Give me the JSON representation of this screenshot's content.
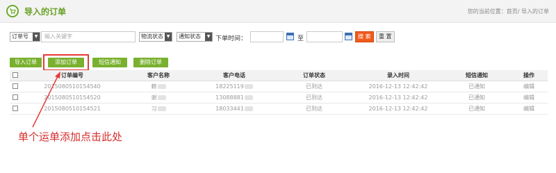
{
  "header": {
    "title": "导入的订单",
    "breadcrumb": "您的当前位置：首页/ 导入的订单"
  },
  "filters": {
    "order_field_select": "订单号",
    "keyword_placeholder": "输入关键字",
    "logistics_select": "物流状态",
    "notify_select": "通知状态",
    "time_label": "下单时间：",
    "to_label": "至",
    "search_button": "搜 索",
    "reset_button": "重 置"
  },
  "actions": {
    "import": "导入订单",
    "add": "添加订单",
    "sms": "短信通知",
    "delete": "删除订单"
  },
  "table": {
    "headers": [
      "订单编号",
      "客户名称",
      "客户电话",
      "订单状态",
      "录入时间",
      "短信通知",
      "操作"
    ],
    "rows": [
      {
        "order_no": "2015080510154540",
        "customer": "赖",
        "phone": "18225119",
        "status": "已到达",
        "time": "2016-12-13 12:42:42",
        "sms": "已通知",
        "op": "编辑"
      },
      {
        "order_no": "2015080510154520",
        "customer": "谢",
        "phone": "13088881",
        "status": "已到达",
        "time": "2016-12-13 12:42:42",
        "sms": "已通知",
        "op": "编辑"
      },
      {
        "order_no": "2015080510154521",
        "customer": "习",
        "phone": "18033441",
        "status": "已到达",
        "time": "2016-12-13 12:42:42",
        "sms": "已通知",
        "op": "编辑"
      }
    ]
  },
  "annotation": "单个运单添加点击此处",
  "colors": {
    "accent_green": "#79b12f",
    "search_orange": "#f05a1a",
    "annotation_red": "#d52d2d"
  }
}
